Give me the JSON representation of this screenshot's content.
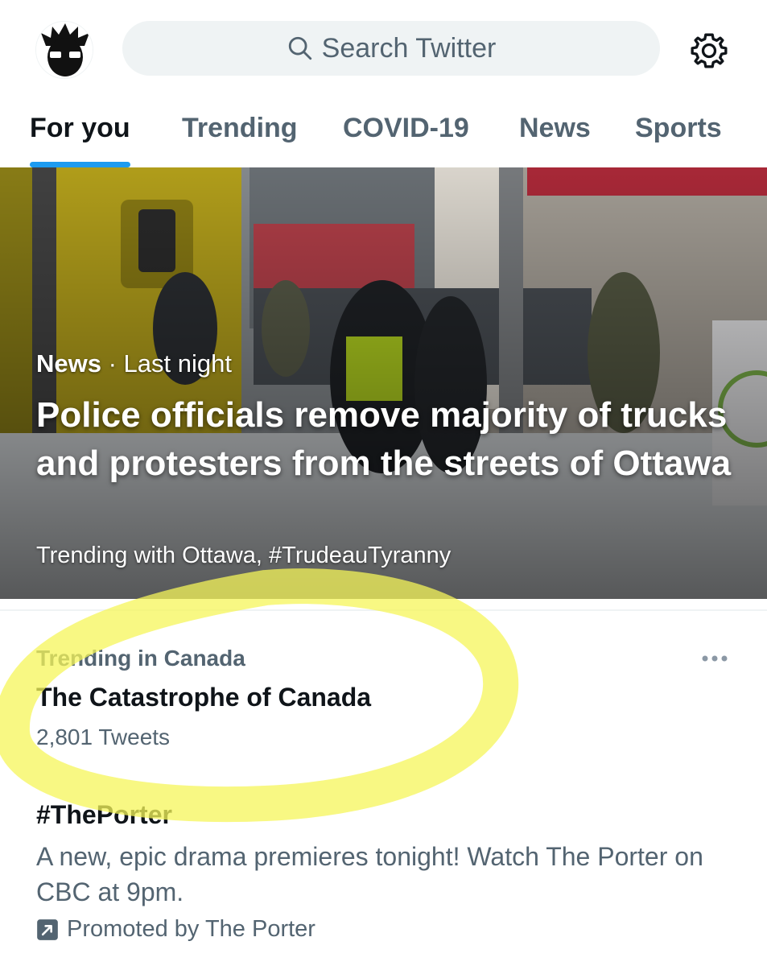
{
  "search": {
    "placeholder": "Search Twitter"
  },
  "tabs": [
    {
      "label": "For you",
      "active": true
    },
    {
      "label": "Trending",
      "active": false
    },
    {
      "label": "COVID-19",
      "active": false
    },
    {
      "label": "News",
      "active": false
    },
    {
      "label": "Sports",
      "active": false
    }
  ],
  "hero": {
    "source": "News",
    "separator": " · ",
    "time": "Last night",
    "title": "Police officials remove majority of trucks and protesters from the streets of Ottawa",
    "trending_with": "Trending with Ottawa, #TrudeauTyranny"
  },
  "trends": [
    {
      "context": "Trending in Canada",
      "name": "The Catastrophe of Canada",
      "count": "2,801 Tweets"
    }
  ],
  "promoted": {
    "name": "#ThePorter",
    "description": "A new, epic drama premieres tonight! Watch The Porter on CBC at 9pm.",
    "promoted_by": "Promoted by The Porter"
  },
  "colors": {
    "accent": "#1d9bf0",
    "text_primary": "#0f1419",
    "text_secondary": "#536471",
    "highlight": "#f5f55a"
  },
  "icons": {
    "avatar": "avatar-icon",
    "search": "search-icon",
    "settings": "gear-icon",
    "more": "more-icon",
    "promoted": "promoted-icon"
  }
}
